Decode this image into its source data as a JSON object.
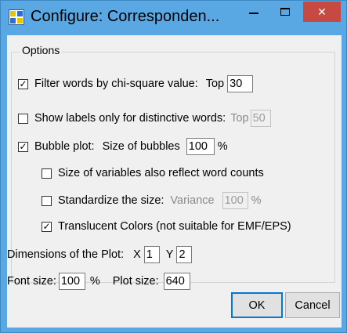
{
  "window": {
    "title": "Configure: Corresponden...",
    "close_glyph": "✕"
  },
  "options": {
    "legend": "Options",
    "filter_words": {
      "checked": true,
      "label": "Filter words by chi-square value:",
      "top_label": "Top",
      "top_value": "30"
    },
    "show_labels": {
      "checked": false,
      "label": "Show labels only for distinctive words:",
      "top_label": "Top",
      "top_value": "50"
    },
    "bubble_plot": {
      "checked": true,
      "label": "Bubble plot:",
      "size_label": "Size of bubbles",
      "size_value": "100",
      "unit": "%"
    },
    "size_reflect": {
      "checked": false,
      "label": "Size of variables also reflect word counts"
    },
    "standardize": {
      "checked": false,
      "label": "Standardize the size:",
      "variance_label": "Variance",
      "variance_value": "100",
      "unit": "%"
    },
    "translucent": {
      "checked": true,
      "label": "Translucent Colors (not suitable for EMF/EPS)"
    }
  },
  "dimensions": {
    "label": "Dimensions of the Plot:",
    "x_label": "X",
    "x_value": "1",
    "y_label": "Y",
    "y_value": "2"
  },
  "font_row": {
    "font_label": "Font size:",
    "font_value": "100",
    "font_unit": "%",
    "plot_label": "Plot size:",
    "plot_value": "640"
  },
  "buttons": {
    "ok": "OK",
    "cancel": "Cancel"
  },
  "check_glyph": "✓"
}
